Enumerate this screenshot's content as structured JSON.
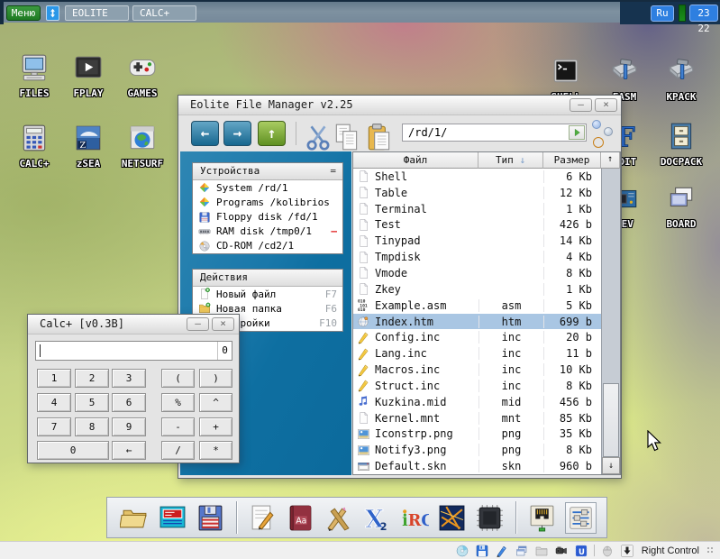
{
  "taskbar": {
    "menu_label": "Меню",
    "window_switch_glyph": "updown-arrows",
    "task_buttons": [
      "EOLITE",
      "CALC+"
    ],
    "language": "Ru",
    "clock": "23 22"
  },
  "window_controls": {
    "minimize": "–",
    "close": "×"
  },
  "desktop": {
    "icons_left": [
      {
        "label": "FILES",
        "icon": "computer"
      },
      {
        "label": "FPLAY",
        "icon": "player"
      },
      {
        "label": "GAMES",
        "icon": "gamepad"
      },
      {
        "label": "CALC+",
        "icon": "calculator"
      },
      {
        "label": "zSEA",
        "icon": "zsea"
      },
      {
        "label": "NETSURF",
        "icon": "netsurf"
      }
    ],
    "icons_right": [
      {
        "label": "SHELL",
        "icon": "terminal"
      },
      {
        "label": "FASM",
        "icon": "hammer"
      },
      {
        "label": "KPACK",
        "icon": "hammer"
      },
      {
        "label": "EDIT",
        "icon": "tedit"
      },
      {
        "label": "DOCPACK",
        "icon": "drawer"
      },
      {
        "label": "DEV",
        "icon": "devboard"
      },
      {
        "label": "BOARD",
        "icon": "board"
      }
    ]
  },
  "eolite": {
    "title": "Eolite File Manager v2.25",
    "toolbar": {
      "back": "←",
      "forward": "→",
      "up": "↑",
      "path": "/rd/1/"
    },
    "devices": {
      "header": "Устройства",
      "menu_glyph": "=",
      "items": [
        {
          "icon": "diamond",
          "label": "System /rd/1"
        },
        {
          "icon": "diamond",
          "label": "Programs /kolibrios"
        },
        {
          "icon": "minifloppy",
          "label": "Floppy disk /fd/1"
        },
        {
          "icon": "ram",
          "label": "RAM disk /tmp0/1",
          "badge": "–"
        },
        {
          "icon": "cdrom",
          "label": "CD-ROM /cd2/1"
        }
      ]
    },
    "actions": {
      "header": "Действия",
      "items": [
        {
          "icon": "newfile",
          "label": "Новый файл",
          "key": "F7"
        },
        {
          "icon": "newfolder",
          "label": "Новая папка",
          "key": "F6"
        },
        {
          "icon": "gear",
          "label": "Настройки",
          "key": "F10"
        }
      ]
    },
    "files": {
      "columns": {
        "name": "Файл",
        "type": "Тип",
        "size": "Размер"
      },
      "sort_glyph": "↓",
      "scroll_up": "↑",
      "scroll_down": "↓",
      "rows": [
        {
          "icon": "doc",
          "name": "Shell",
          "type": "",
          "size": "6 Kb"
        },
        {
          "icon": "doc",
          "name": "Table",
          "type": "",
          "size": "12 Kb"
        },
        {
          "icon": "doc",
          "name": "Terminal",
          "type": "",
          "size": "1 Kb"
        },
        {
          "icon": "doc",
          "name": "Test",
          "type": "",
          "size": "426 b"
        },
        {
          "icon": "doc",
          "name": "Tinypad",
          "type": "",
          "size": "14 Kb"
        },
        {
          "icon": "doc",
          "name": "Tmpdisk",
          "type": "",
          "size": "4 Kb"
        },
        {
          "icon": "doc",
          "name": "Vmode",
          "type": "",
          "size": "8 Kb"
        },
        {
          "icon": "doc",
          "name": "Zkey",
          "type": "",
          "size": "1 Kb"
        },
        {
          "icon": "asm",
          "name": "Example.asm",
          "type": "asm",
          "size": "5 Kb"
        },
        {
          "icon": "htm",
          "name": "Index.htm",
          "type": "htm",
          "size": "699 b",
          "selected": true
        },
        {
          "icon": "inc",
          "name": "Config.inc",
          "type": "inc",
          "size": "20 b"
        },
        {
          "icon": "inc",
          "name": "Lang.inc",
          "type": "inc",
          "size": "11 b"
        },
        {
          "icon": "inc",
          "name": "Macros.inc",
          "type": "inc",
          "size": "10 Kb"
        },
        {
          "icon": "inc",
          "name": "Struct.inc",
          "type": "inc",
          "size": "8 Kb"
        },
        {
          "icon": "mid",
          "name": "Kuzkina.mid",
          "type": "mid",
          "size": "456 b"
        },
        {
          "icon": "doc",
          "name": "Kernel.mnt",
          "type": "mnt",
          "size": "85 Kb"
        },
        {
          "icon": "png",
          "name": "Iconstrp.png",
          "type": "png",
          "size": "35 Kb"
        },
        {
          "icon": "png",
          "name": "Notify3.png",
          "type": "png",
          "size": "8 Kb"
        },
        {
          "icon": "skn",
          "name": "Default.skn",
          "type": "skn",
          "size": "960 b"
        }
      ]
    }
  },
  "calc": {
    "title": "Calc+ [v0.3B]",
    "display_value": "0",
    "left_keys": [
      [
        "1",
        "2",
        "3"
      ],
      [
        "4",
        "5",
        "6"
      ],
      [
        "7",
        "8",
        "9"
      ],
      [
        "0",
        "←"
      ]
    ],
    "right_keys": [
      [
        "(",
        ")"
      ],
      [
        "%",
        "^"
      ],
      [
        "-",
        "+"
      ],
      [
        "/",
        "*"
      ]
    ]
  },
  "dock": {
    "items": [
      {
        "icon": "dockfolder",
        "name": "file-manager"
      },
      {
        "icon": "sysmon",
        "name": "system-monitor"
      },
      {
        "icon": "dockfloppy",
        "name": "floppy-tool"
      },
      {
        "separator": true
      },
      {
        "icon": "notepad",
        "name": "text-editor"
      },
      {
        "icon": "dict",
        "name": "dictionary"
      },
      {
        "icon": "tools",
        "name": "graphics-editor"
      },
      {
        "icon": "gamesx",
        "name": "games"
      },
      {
        "icon": "irc",
        "name": "irc-client"
      },
      {
        "icon": "linesgame",
        "name": "lines-game"
      },
      {
        "icon": "cpuchip",
        "name": "cpu-monitor"
      },
      {
        "separator": true
      },
      {
        "icon": "network",
        "name": "network"
      },
      {
        "icon": "sliders",
        "name": "settings",
        "framed": true
      }
    ]
  },
  "statusbar": {
    "label": "Right Control",
    "items": [
      {
        "icon": "disc",
        "name": "cd-drive"
      },
      {
        "icon": "save",
        "name": "save"
      },
      {
        "icon": "pen",
        "name": "pen"
      },
      {
        "icon": "winstack",
        "name": "windows"
      },
      {
        "icon": "grayfolder",
        "name": "folder"
      },
      {
        "icon": "camera",
        "name": "camera"
      },
      {
        "icon": "usb",
        "name": "usb"
      },
      {
        "separator": true
      },
      {
        "icon": "mouse",
        "name": "mouse"
      },
      {
        "icon": "downbtn",
        "name": "keyboard-layout-switch"
      }
    ]
  },
  "colors": {
    "accent_blue": "#2e7fe0",
    "selection": "#a9c6e3",
    "sidebar_blue": "#0f72a4",
    "menu_green": "#2a8a2e"
  }
}
